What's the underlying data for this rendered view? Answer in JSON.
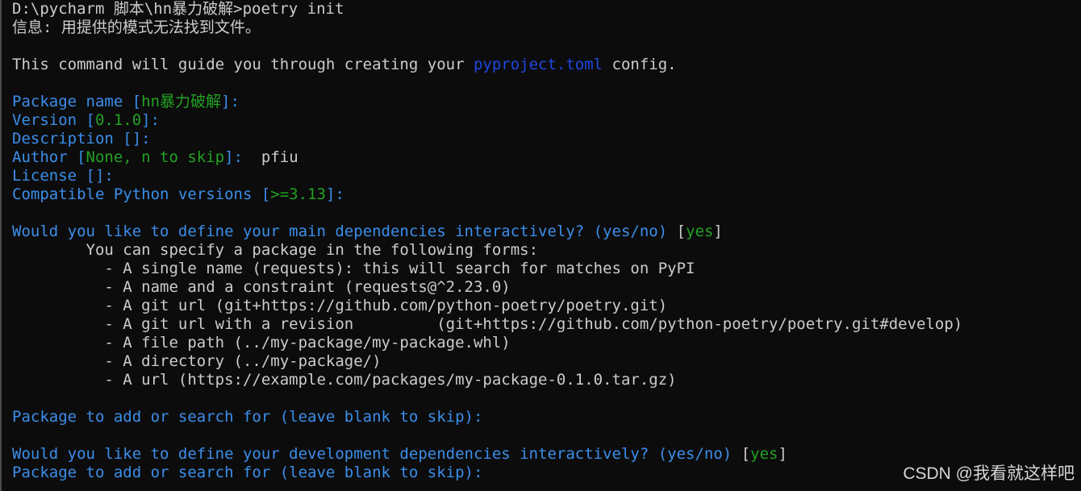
{
  "colors": {
    "background": "#0c0c0c",
    "text": "#cccccc",
    "prompt_blue": "#3b8eea",
    "default_green": "#23a123",
    "link_blue": "#1f47e0"
  },
  "terminal": {
    "cmd_line": "D:\\pycharm 脚本\\hn暴力破解>poetry init",
    "info_line": "信息: 用提供的模式无法找到文件。",
    "guide_pre": "This command will guide you through creating your ",
    "guide_link": "pyproject.toml",
    "guide_post": " config.",
    "pkg_name_label": "Package name [",
    "pkg_name_default": "hn暴力破解",
    "pkg_name_end": "]:",
    "version_label": "Version [",
    "version_default": "0.1.0",
    "version_end": "]:",
    "description_label": "Description []:",
    "author_label": "Author [",
    "author_default": "None, n to skip",
    "author_end": "]:",
    "author_input": "  pfiu",
    "license_label": "License []:",
    "python_label": "Compatible Python versions [",
    "python_default": ">=3.13",
    "python_end": "]:",
    "main_deps_q": "Would you like to define your main dependencies interactively? (yes/no)",
    "main_deps_open": " [",
    "main_deps_default": "yes",
    "main_deps_close": "]",
    "forms_intro": "        You can specify a package in the following forms:",
    "forms": [
      "          - A single name (requests): this will search for matches on PyPI",
      "          - A name and a constraint (requests@^2.23.0)",
      "          - A git url (git+https://github.com/python-poetry/poetry.git)",
      "          - A git url with a revision         (git+https://github.com/python-poetry/poetry.git#develop)",
      "          - A file path (../my-package/my-package.whl)",
      "          - A directory (../my-package/)",
      "          - A url (https://example.com/packages/my-package-0.1.0.tar.gz)"
    ],
    "add_pkg_1": "Package to add or search for (leave blank to skip):",
    "dev_deps_q": "Would you like to define your development dependencies interactively? (yes/no)",
    "dev_deps_open": " [",
    "dev_deps_default": "yes",
    "dev_deps_close": "]",
    "add_pkg_2": "Package to add or search for (leave blank to skip):"
  },
  "watermark": "CSDN @我看就这样吧"
}
